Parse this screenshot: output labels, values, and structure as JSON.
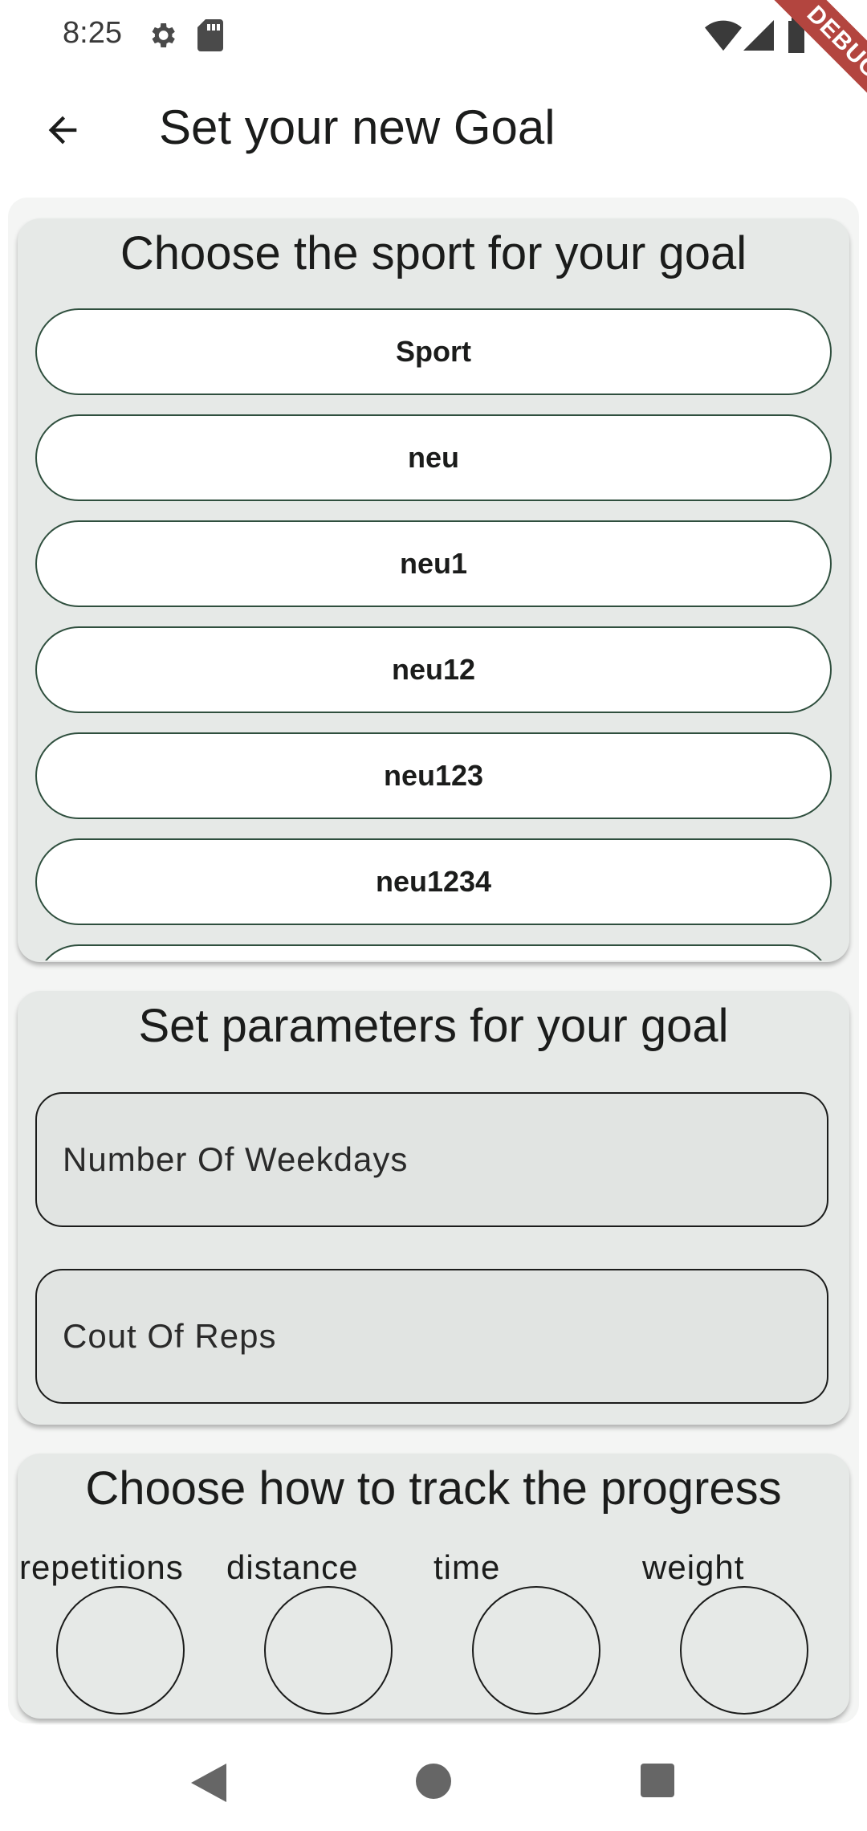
{
  "status_bar": {
    "time": "8:25",
    "icons": [
      "settings-icon",
      "sd-card-icon",
      "wifi-icon",
      "signal-icon",
      "battery-icon"
    ],
    "debug_banner": "DEBUG"
  },
  "app_bar": {
    "back_icon": "arrow-back-icon",
    "title": "Set your new Goal"
  },
  "sport_section": {
    "title": "Choose the sport for your goal",
    "sports": [
      "Sport",
      "neu",
      "neu1",
      "neu12",
      "neu123",
      "neu1234"
    ]
  },
  "parameters_section": {
    "title": "Set parameters for your goal",
    "fields": [
      {
        "label": "Number Of Weekdays",
        "value": ""
      },
      {
        "label": "Cout Of Reps",
        "value": ""
      }
    ]
  },
  "tracking_section": {
    "title": "Choose how to track the progress",
    "options": [
      {
        "label": "repetitions",
        "selected": false
      },
      {
        "label": "distance",
        "selected": false
      },
      {
        "label": "time",
        "selected": false
      },
      {
        "label": "weight",
        "selected": false
      }
    ]
  },
  "nav_bar": {
    "icons": [
      "nav-back-icon",
      "nav-home-icon",
      "nav-recents-icon"
    ]
  },
  "colors": {
    "panel_background": "#e6e9e7",
    "button_border": "#2f4f3e",
    "debug_ribbon": "#b3453f"
  }
}
